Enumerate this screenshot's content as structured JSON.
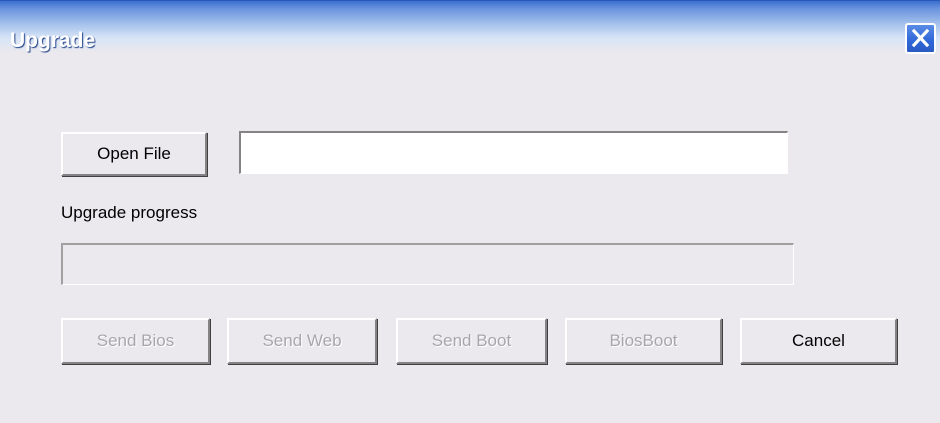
{
  "window": {
    "title": "Upgrade",
    "close_icon": "close-icon"
  },
  "file": {
    "open_label": "Open File",
    "path_value": ""
  },
  "progress": {
    "label": "Upgrade progress",
    "value": 0
  },
  "actions": {
    "send_bios": "Send Bios",
    "send_web": "Send Web",
    "send_boot": "Send Boot",
    "biosboot": "BiosBoot",
    "cancel": "Cancel"
  },
  "colors": {
    "titlebar_blue": "#3b6fce",
    "dialog_bg": "#ebe9ed",
    "disabled_text": "#a8a6ac",
    "close_button": "#2f66d8"
  }
}
